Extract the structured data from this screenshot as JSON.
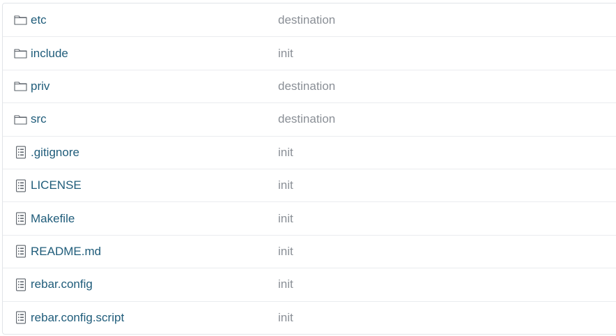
{
  "files": [
    {
      "name": "etc",
      "type": "folder",
      "icon": "folder-icon",
      "message": "destination"
    },
    {
      "name": "include",
      "type": "folder",
      "icon": "folder-icon",
      "message": "init"
    },
    {
      "name": "priv",
      "type": "folder",
      "icon": "folder-icon",
      "message": "destination"
    },
    {
      "name": "src",
      "type": "folder",
      "icon": "folder-icon",
      "message": "destination"
    },
    {
      "name": ".gitignore",
      "type": "file",
      "icon": "file-icon",
      "message": "init"
    },
    {
      "name": "LICENSE",
      "type": "file",
      "icon": "file-icon",
      "message": "init"
    },
    {
      "name": "Makefile",
      "type": "file",
      "icon": "file-icon",
      "message": "init"
    },
    {
      "name": "README.md",
      "type": "file",
      "icon": "file-icon",
      "message": "init"
    },
    {
      "name": "rebar.config",
      "type": "file",
      "icon": "file-icon",
      "message": "init"
    },
    {
      "name": "rebar.config.script",
      "type": "file",
      "icon": "file-icon",
      "message": "init"
    }
  ],
  "colors": {
    "link": "#1f5c7a",
    "message": "#8a8f96",
    "icon": "#5a6068",
    "border": "#eaecef"
  }
}
